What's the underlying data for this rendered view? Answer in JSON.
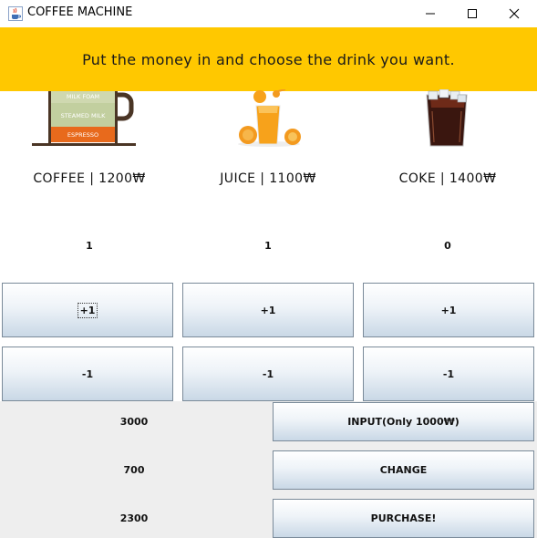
{
  "window": {
    "title": "COFFEE MACHINE",
    "app_icon": "java-cup-icon",
    "controls": [
      "minimize-icon",
      "maximize-icon",
      "close-icon"
    ]
  },
  "banner": {
    "message": "Put the money in and choose the drink you want.",
    "color": "#ffc800"
  },
  "products": [
    {
      "id": "coffee",
      "label": "COFFEE | 1200₩",
      "count": "1",
      "plus_label": "+1",
      "minus_label": "-1",
      "image": {
        "icon": "latte-glass-icon",
        "layers": [
          "MILK FOAM",
          "STEAMED MILK",
          "ESPRESSO"
        ]
      }
    },
    {
      "id": "juice",
      "label": "JUICE | 1100₩",
      "count": "1",
      "plus_label": "+1",
      "minus_label": "-1",
      "image": {
        "icon": "orange-juice-icon"
      }
    },
    {
      "id": "coke",
      "label": "COKE | 1400₩",
      "count": "0",
      "plus_label": "+1",
      "minus_label": "-1",
      "image": {
        "icon": "cola-glass-icon"
      }
    }
  ],
  "money": {
    "inserted": "3000",
    "change": "700",
    "total": "2300"
  },
  "actions": {
    "input_label": "INPUT(Only 1000₩)",
    "change_label": "CHANGE",
    "purchase_label": "PURCHASE!"
  },
  "colors": {
    "panel_bg": "#eeeeee",
    "button_gradient_top": "#ffffff",
    "button_gradient_bottom": "#c9d8e6",
    "button_border": "#7a8a99"
  }
}
